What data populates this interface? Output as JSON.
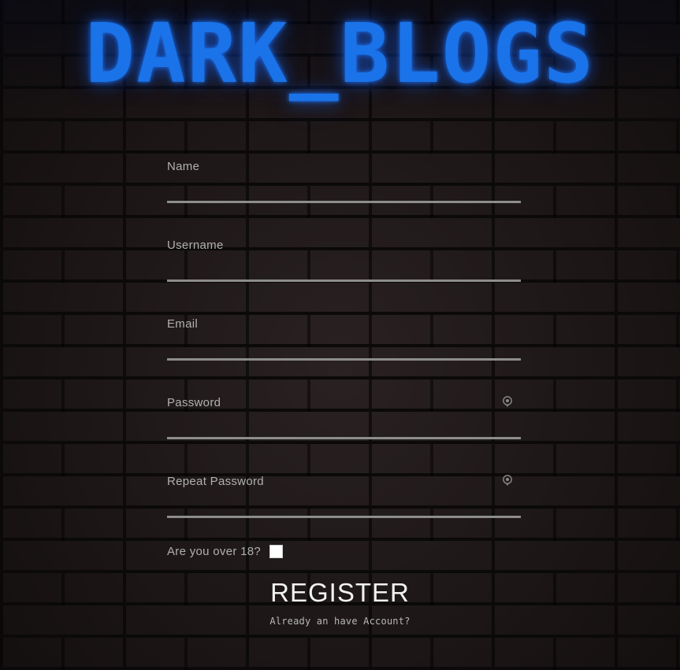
{
  "site": {
    "logo_text": "DARK_BLOGS",
    "logo_color": "#1a73e8"
  },
  "form": {
    "fields": [
      {
        "label": "Name",
        "value": ""
      },
      {
        "label": "Username",
        "value": ""
      },
      {
        "label": "Email",
        "value": ""
      },
      {
        "label": "Password",
        "value": "",
        "icon": "eye-icon"
      },
      {
        "label": "Repeat Password",
        "value": "",
        "icon": "eye-icon"
      }
    ],
    "age_check": {
      "label": "Are you over 18?",
      "checked": false
    },
    "register_label": "REGISTER",
    "login_link_text": "Already an have Account?"
  }
}
